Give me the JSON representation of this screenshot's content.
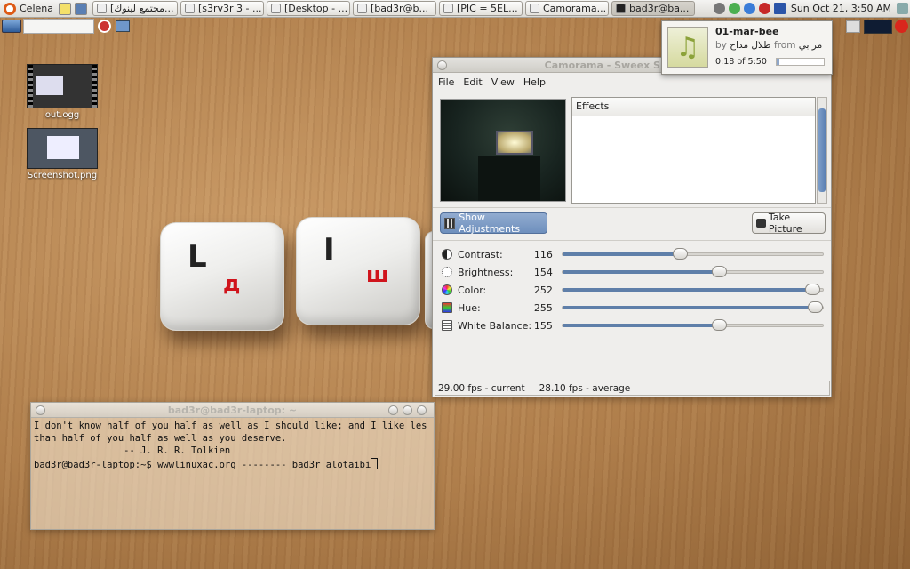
{
  "top_panel": {
    "menu_label": "Celena",
    "tasks": [
      {
        "label": "[مجتمع لينوك..."
      },
      {
        "label": "[s3rv3r 3 - ..."
      },
      {
        "label": "[Desktop - ..."
      },
      {
        "label": "[bad3r@b..."
      },
      {
        "label": "[PIC = 5EL..."
      },
      {
        "label": "Camorama..."
      },
      {
        "label": "bad3r@ba..."
      }
    ],
    "clock": "Sun Oct 21,  3:50 AM"
  },
  "desktop_icons": [
    {
      "label": "out.ogg"
    },
    {
      "label": "Screenshot.png"
    }
  ],
  "keycaps": [
    {
      "latin": "L",
      "cyrillic": "д"
    },
    {
      "latin": "I",
      "cyrillic": "ш"
    }
  ],
  "notification": {
    "title": "01-mar-bee",
    "by_label": "by",
    "artist": "طلال مداح",
    "from_label": "from",
    "album": "مر بي",
    "time": "0:18 of 5:50",
    "progress": 0.05
  },
  "camorama": {
    "title": "Camorama - Sweex SIF webcam",
    "menu": [
      "File",
      "Edit",
      "View",
      "Help"
    ],
    "effects_header": "Effects",
    "show_adjustments": "Show Adjustments",
    "take_picture": "Take Picture",
    "adjustments": [
      {
        "label": "Contrast:",
        "value": "116",
        "level": 0.45
      },
      {
        "label": "Brightness:",
        "value": "154",
        "level": 0.6
      },
      {
        "label": "Color:",
        "value": "252",
        "level": 0.96
      },
      {
        "label": "Hue:",
        "value": "255",
        "level": 0.97
      },
      {
        "label": "White Balance:",
        "value": "155",
        "level": 0.6
      }
    ],
    "status_current": "29.00 fps - current",
    "status_average": "28.10 fps - average"
  },
  "terminal": {
    "title": "bad3r@bad3r-laptop: ~",
    "lines": [
      "I don't know half of you half as well as I should like; and I like les",
      "than half of you half as well as you deserve.",
      "                -- J. R. R. Tolkien",
      "bad3r@bad3r-laptop:~$ wwwlinuxac.org -------- bad3r alotaibi"
    ]
  },
  "colors": {
    "accent": "#6e8fbd",
    "slider_fill": "#5f7fa9",
    "key_letter_red": "#d0141c"
  }
}
